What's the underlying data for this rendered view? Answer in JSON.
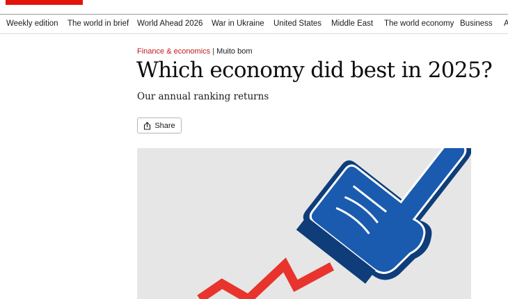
{
  "brand": {
    "accent_color": "#e3120b"
  },
  "nav": {
    "items": [
      "Weekly edition",
      "The world in brief",
      "World Ahead 2026",
      "War in Ukraine",
      "United States",
      "Middle East",
      "The world economy",
      "Business",
      "A"
    ]
  },
  "article": {
    "section": "Finance & economics",
    "separator": "|",
    "flytitle": "Muito bom",
    "headline": "Which economy did best in 2025?",
    "standfirst": "Our annual ranking returns",
    "share_label": "Share",
    "share_icon": "share-icon",
    "section_color": "#c0181c"
  },
  "hero_image": {
    "subject": "foam-finger-icon",
    "colors": {
      "background": "#e6e6e6",
      "finger": "#1a5bb0",
      "arrow": "#e8342d"
    }
  }
}
